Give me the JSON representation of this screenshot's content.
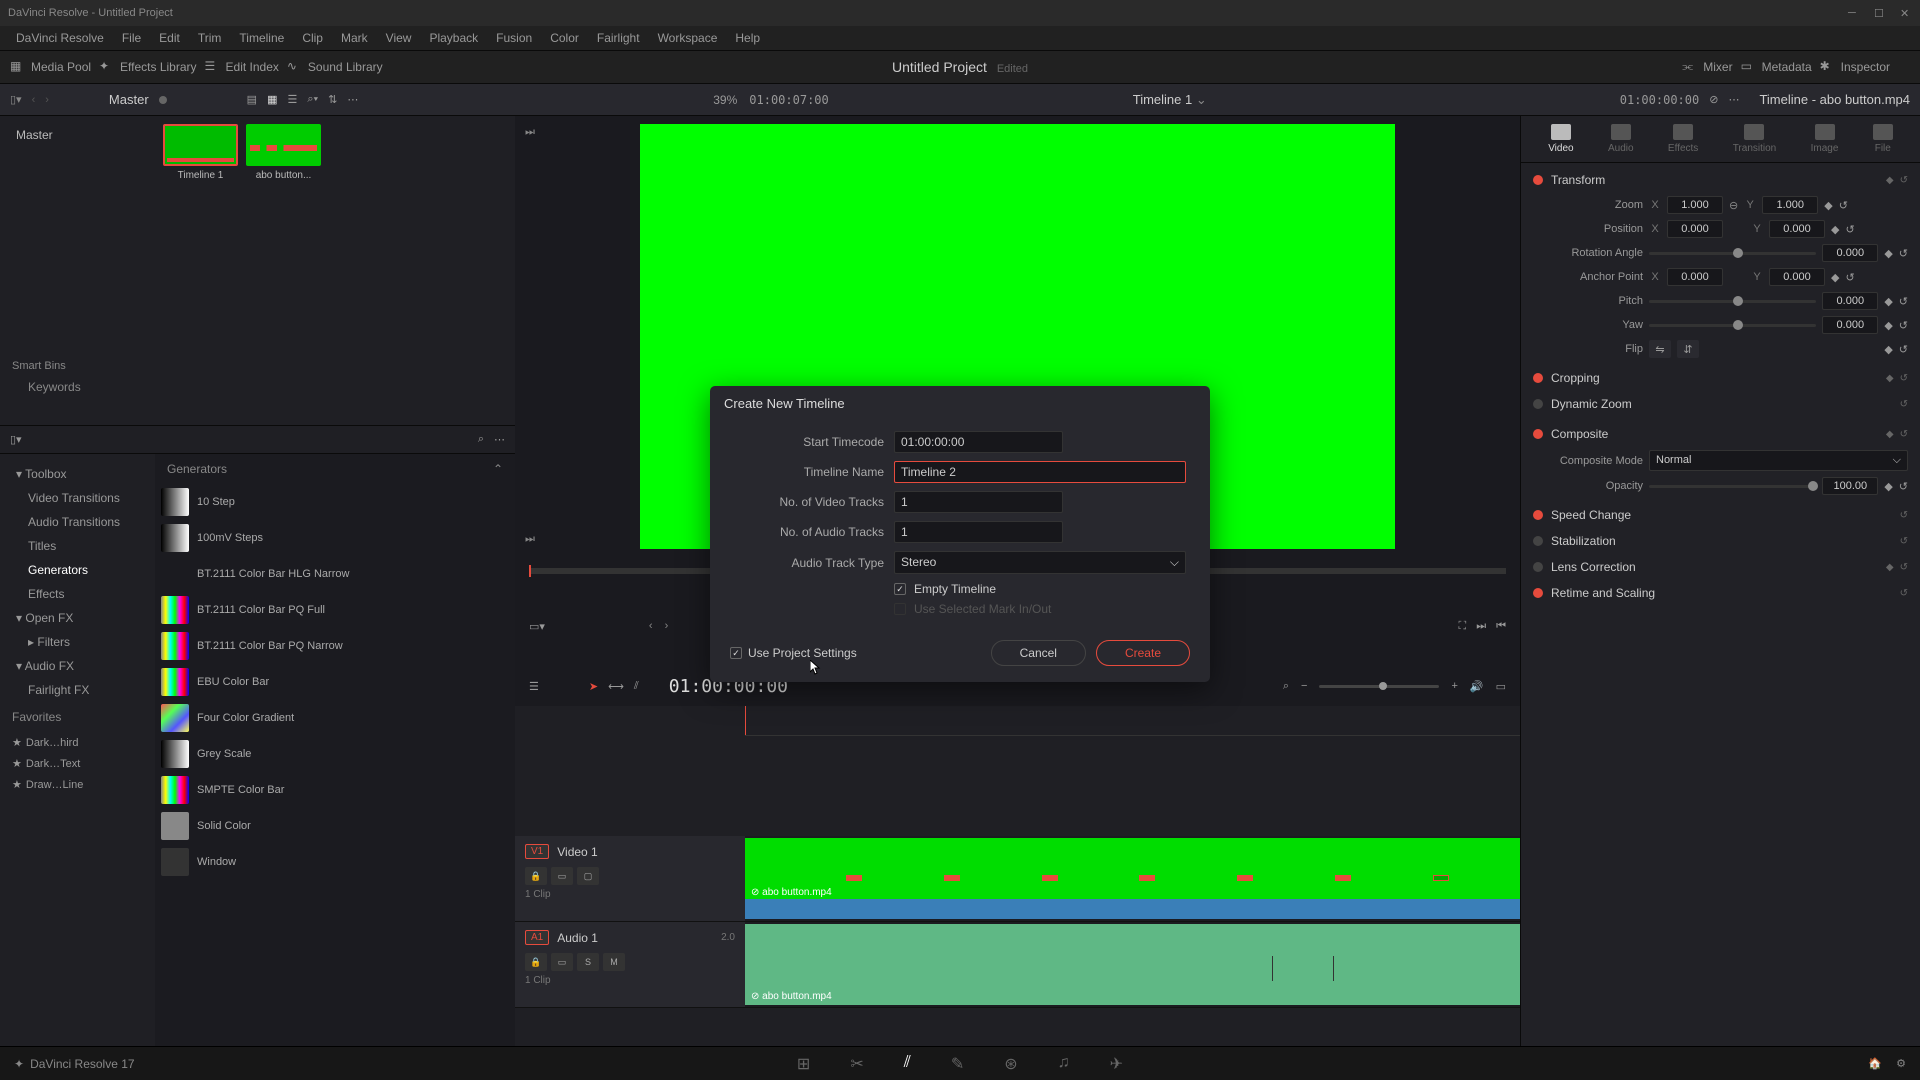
{
  "app": {
    "title": "DaVinci Resolve - Untitled Project",
    "version": "DaVinci Resolve 17"
  },
  "menu": [
    "DaVinci Resolve",
    "File",
    "Edit",
    "Trim",
    "Timeline",
    "Clip",
    "Mark",
    "View",
    "Playback",
    "Fusion",
    "Color",
    "Fairlight",
    "Workspace",
    "Help"
  ],
  "toolbar": {
    "media_pool": "Media Pool",
    "effects_lib": "Effects Library",
    "edit_index": "Edit Index",
    "sound_lib": "Sound Library",
    "mixer": "Mixer",
    "metadata": "Metadata",
    "inspector": "Inspector"
  },
  "project": {
    "title": "Untitled Project",
    "status": "Edited"
  },
  "secondary": {
    "bin": "Master",
    "zoom": "39%",
    "tc": "01:00:07:00",
    "timeline": "Timeline 1",
    "tc_right": "01:00:00:00",
    "insp_title": "Timeline - abo button.mp4"
  },
  "media": {
    "root_bin": "Master",
    "smart_bins": "Smart Bins",
    "keywords": "Keywords",
    "clips": [
      {
        "name": "Timeline 1",
        "sel": true
      },
      {
        "name": "abo button..."
      }
    ]
  },
  "effects_sidebar": {
    "toolbox": "Toolbox",
    "items": [
      "Video Transitions",
      "Audio Transitions",
      "Titles",
      "Generators",
      "Effects"
    ],
    "openfx": "Open FX",
    "filters": "Filters",
    "audiofx": "Audio FX",
    "fairlightfx": "Fairlight FX",
    "favorites": "Favorites",
    "favlist": [
      "Dark…hird",
      "Dark…Text",
      "Draw…Line"
    ]
  },
  "generators": {
    "header": "Generators",
    "items": [
      "10 Step",
      "100mV Steps",
      "BT.2111 Color Bar HLG Narrow",
      "BT.2111 Color Bar PQ Full",
      "BT.2111 Color Bar PQ Narrow",
      "EBU Color Bar",
      "Four Color Gradient",
      "Grey Scale",
      "SMPTE Color Bar",
      "Solid Color",
      "Window"
    ]
  },
  "transport": {
    "tc": "01:00:00:00"
  },
  "tracks": {
    "v1": {
      "badge": "V1",
      "name": "Video 1",
      "count": "1 Clip",
      "clip": "abo button.mp4"
    },
    "a1": {
      "badge": "A1",
      "name": "Audio 1",
      "count": "1 Clip",
      "clip": "abo button.mp4",
      "level": "2.0"
    }
  },
  "inspector": {
    "tabs": [
      "Video",
      "Audio",
      "Effects",
      "Transition",
      "Image",
      "File"
    ],
    "transform": {
      "title": "Transform",
      "zoom": "Zoom",
      "zx": "1.000",
      "zy": "1.000",
      "position": "Position",
      "px": "0.000",
      "py": "0.000",
      "rotation": "Rotation Angle",
      "rv": "0.000",
      "anchor": "Anchor Point",
      "ax": "0.000",
      "ay": "0.000",
      "pitch": "Pitch",
      "pv": "0.000",
      "yaw": "Yaw",
      "yv": "0.000",
      "flip": "Flip"
    },
    "cropping": "Cropping",
    "dynzoom": "Dynamic Zoom",
    "composite": "Composite",
    "comp_mode_label": "Composite Mode",
    "comp_mode": "Normal",
    "opacity_label": "Opacity",
    "opacity": "100.00",
    "speed": "Speed Change",
    "stab": "Stabilization",
    "lens": "Lens Correction",
    "retime": "Retime and Scaling"
  },
  "dialog": {
    "title": "Create New Timeline",
    "start_tc_label": "Start Timecode",
    "start_tc": "01:00:00:00",
    "name_label": "Timeline Name",
    "name": "Timeline 2",
    "vtracks_label": "No. of Video Tracks",
    "vtracks": "1",
    "atracks_label": "No. of Audio Tracks",
    "atracks": "1",
    "atype_label": "Audio Track Type",
    "atype": "Stereo",
    "empty": "Empty Timeline",
    "use_marks": "Use Selected Mark In/Out",
    "use_project": "Use Project Settings",
    "cancel": "Cancel",
    "create": "Create"
  }
}
